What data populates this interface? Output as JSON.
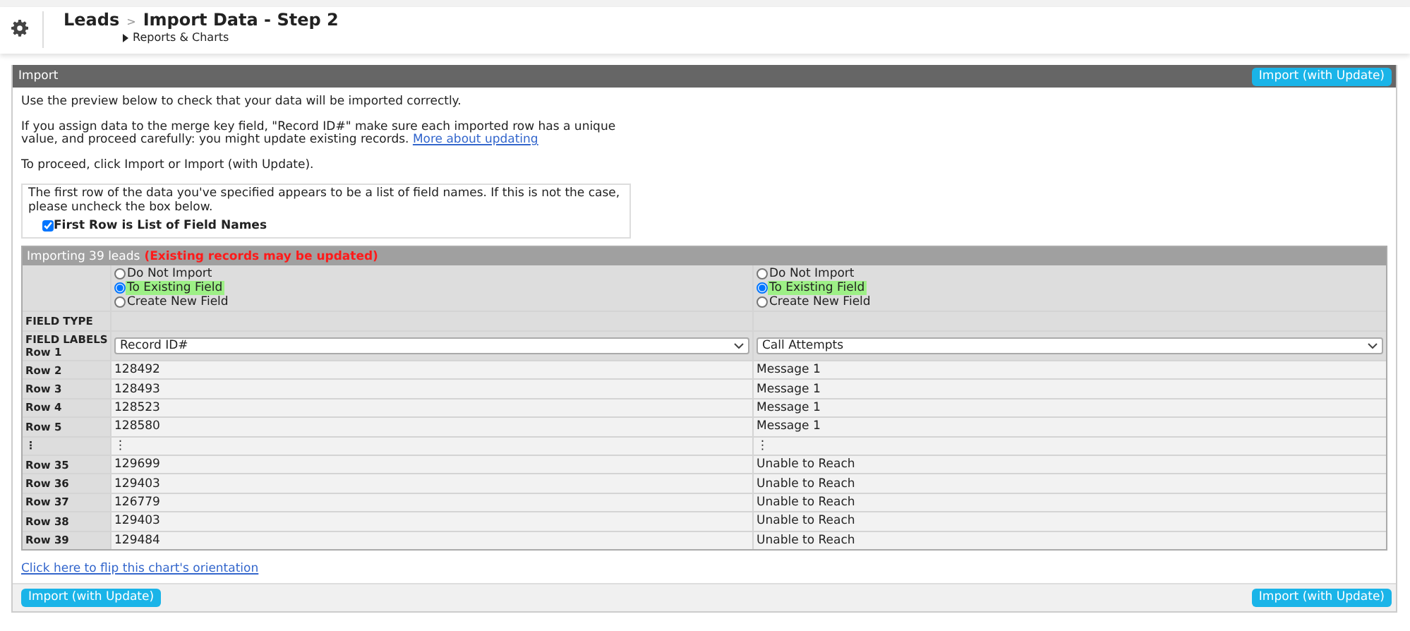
{
  "header": {
    "root": "Leads",
    "separator": ">",
    "title": "Import Data - Step 2",
    "sublink": "Reports & Charts"
  },
  "panel": {
    "title": "Import",
    "top_button": "Import (with Update)",
    "intro": [
      {
        "text": "Use the preview below to check that your data will be imported correctly."
      },
      {
        "text": "If you assign data to the merge key field, \"Record ID#\" make sure each imported row has a unique value, and proceed carefully: you might update existing records.",
        "link": "More about updating"
      },
      {
        "text": "To proceed, click Import or Import (with Update)."
      }
    ],
    "notice": {
      "text": "The first row of the data you've specified appears to be a list of field names. If this is not the case, please uncheck the box below.",
      "checkbox_label": "First Row is List of Field Names",
      "checked": true
    },
    "preview": {
      "title": "Importing 39 leads",
      "warning": "(Existing records may be updated)",
      "field_type_label": "FIELD TYPE",
      "field_labels_label": "FIELD LABELS",
      "field_labels_row": "Row 1",
      "columns": [
        {
          "options": [
            {
              "label": "Do Not Import",
              "selected": false
            },
            {
              "label": "To Existing Field",
              "selected": true
            },
            {
              "label": "Create New Field",
              "selected": false
            }
          ],
          "field": "Record ID#"
        },
        {
          "options": [
            {
              "label": "Do Not Import",
              "selected": false
            },
            {
              "label": "To Existing Field",
              "selected": true
            },
            {
              "label": "Create New Field",
              "selected": false
            }
          ],
          "field": "Call Attempts"
        }
      ],
      "rows": [
        {
          "label": "Row 2",
          "cells": [
            "128492",
            "Message 1"
          ]
        },
        {
          "label": "Row 3",
          "cells": [
            "128493",
            "Message 1"
          ]
        },
        {
          "label": "Row 4",
          "cells": [
            "128523",
            "Message 1"
          ]
        },
        {
          "label": "Row 5",
          "cells": [
            "128580",
            "Message 1"
          ]
        },
        {
          "label": "⋮",
          "cells": [
            "⋮",
            "⋮"
          ]
        },
        {
          "label": "Row 35",
          "cells": [
            "129699",
            "Unable to Reach"
          ]
        },
        {
          "label": "Row 36",
          "cells": [
            "129403",
            "Unable to Reach"
          ]
        },
        {
          "label": "Row 37",
          "cells": [
            "126779",
            "Unable to Reach"
          ]
        },
        {
          "label": "Row 38",
          "cells": [
            "129403",
            "Unable to Reach"
          ]
        },
        {
          "label": "Row 39",
          "cells": [
            "129484",
            "Unable to Reach"
          ]
        }
      ]
    },
    "flip_link": "Click here to flip this chart's orientation",
    "bottom_buttons": [
      "Import (with Update)",
      "Import (with Update)"
    ]
  }
}
